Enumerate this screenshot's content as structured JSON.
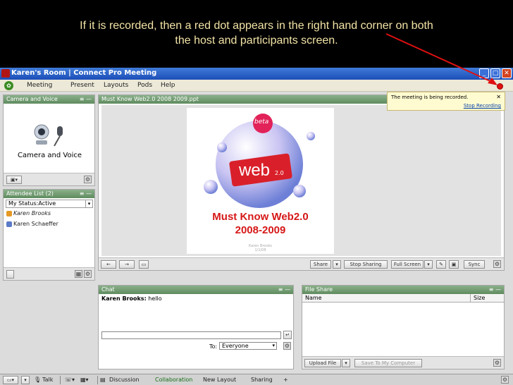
{
  "caption": {
    "line1": "If it is recorded, then a red dot appears in the right hand corner on both",
    "line2": "the host and participants screen."
  },
  "window": {
    "title": "Karen's Room | Connect Pro Meeting",
    "min": "_",
    "max": "□",
    "close": "✕"
  },
  "menu": [
    "Meeting",
    "Present",
    "Layouts",
    "Pods",
    "Help"
  ],
  "recording": {
    "message": "The meeting is being recorded.",
    "close": "✕",
    "stop": "Stop Recording"
  },
  "camera_pod": {
    "title": "Camera and Voice",
    "label": "Camera and Voice"
  },
  "attendee_pod": {
    "title": "Attendee List (2)",
    "status": "My Status:Active",
    "attendees": [
      "Karen Brooks",
      "Karen Schaeffer"
    ]
  },
  "share_pod": {
    "title": "Must Know Web2.0 2008 2009.ppt",
    "slide_badge": "beta",
    "slide_logo": "web",
    "slide_logo_ver": "2.0",
    "slide_title1": "Must Know Web2.0",
    "slide_title2": "2008-2009",
    "slide_author": "Karen Brooks",
    "slide_date": "1/1/08",
    "buttons": {
      "share": "Share",
      "stop": "Stop Sharing",
      "fullscreen": "Full Screen",
      "sync": "Sync"
    }
  },
  "chat_pod": {
    "title": "Chat",
    "messages": [
      {
        "sender": "Karen Brooks:",
        "text": " hello"
      }
    ],
    "to_label": "To:",
    "recipient": "Everyone"
  },
  "file_pod": {
    "title": "File Share",
    "col_name": "Name",
    "col_size": "Size",
    "upload": "Upload File",
    "save": "Save To My Computer"
  },
  "taskbar": {
    "talk": "Talk",
    "tabs": [
      "Discussion",
      "Collaboration",
      "New Layout",
      "Sharing"
    ],
    "add": "+"
  }
}
